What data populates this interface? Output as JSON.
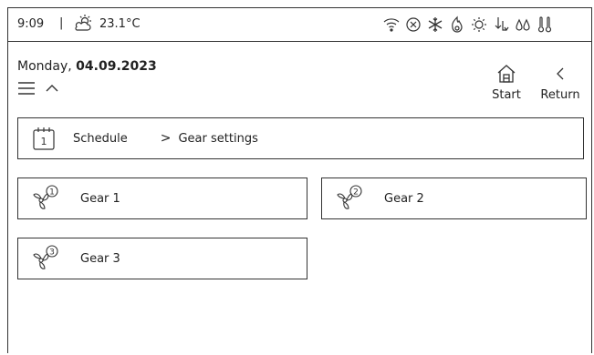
{
  "status": {
    "time": "9:09",
    "separator": "|",
    "temperature": "23.1°C",
    "icons": [
      "wifi-icon",
      "close-circle-icon",
      "snowflake-icon",
      "flame-icon",
      "sun-gear-icon",
      "transfer-icon",
      "water-drops-icon",
      "thermostat-icon"
    ]
  },
  "header": {
    "weekday": "Monday, ",
    "date": "04.09.2023"
  },
  "nav": {
    "start_label": "Start",
    "return_label": "Return"
  },
  "breadcrumb": {
    "calendar_number": "1",
    "item": "Schedule",
    "separator": ">",
    "current": "Gear settings"
  },
  "gears": [
    {
      "label": "Gear 1",
      "number": "1"
    },
    {
      "label": "Gear 2",
      "number": "2"
    },
    {
      "label": "Gear 3",
      "number": "3"
    }
  ]
}
